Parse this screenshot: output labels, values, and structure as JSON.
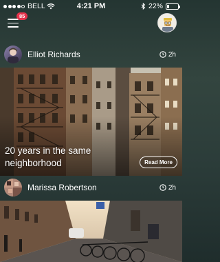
{
  "status_bar": {
    "carrier": "BELL",
    "time": "4:21 PM",
    "battery": "22%",
    "battery_level": 0.22,
    "signal_bars": 4,
    "icons": [
      "signal-dots-icon",
      "wifi-icon",
      "bluetooth-icon",
      "battery-icon"
    ]
  },
  "nav": {
    "notification_count": "85",
    "icons": [
      "hamburger-menu-icon",
      "profile-avatar"
    ]
  },
  "posts": [
    {
      "author": "Elliot Richards",
      "time": "2h",
      "caption_line1": "20 years in the same",
      "caption_line2": "neighborhood",
      "read_more_label": "Read More"
    },
    {
      "author": "Marissa Robertson",
      "time": "2h"
    }
  ],
  "colors": {
    "badge": "#e5334b",
    "background": "#2c3d3a"
  }
}
